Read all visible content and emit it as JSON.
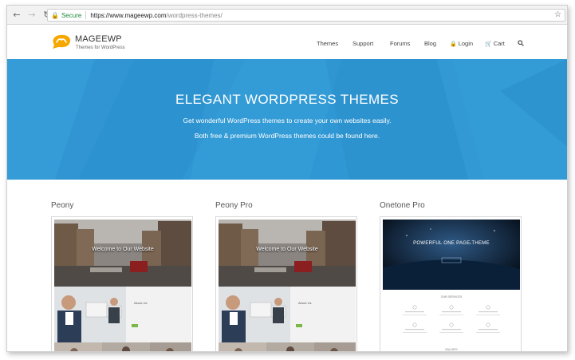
{
  "browser": {
    "back_icon": "arrow-left",
    "forward_icon": "arrow-right",
    "reload_icon": "reload",
    "secure_label": "Secure",
    "url_host": "https://www.mageewp.com",
    "url_path": "/wordpress-themes/",
    "bookmark_icon": "star"
  },
  "site": {
    "logo_title": "MAGEEWP",
    "logo_tagline": "Themes for WordPress",
    "logo_color": "#f6a800",
    "menu": [
      {
        "label": "Themes"
      },
      {
        "label": "Support"
      },
      {
        "label": "Forums"
      },
      {
        "label": "Blog"
      },
      {
        "label": "Login",
        "icon": "lock"
      },
      {
        "label": "Cart",
        "icon": "cart"
      },
      {
        "label": "",
        "icon": "search"
      }
    ]
  },
  "hero": {
    "title": "ELEGANT WORDPRESS THEMES",
    "line1": "Get wonderful WordPress themes to create your own websites easily.",
    "line2": "Both free & premium WordPress themes could be found here.",
    "background_color": "#2f97d3"
  },
  "themes": [
    {
      "name": "Peony",
      "preview_caption": "Welcome to Our Website",
      "preview_heading": "About Us"
    },
    {
      "name": "Peony Pro",
      "preview_caption": "Welcome to Our Website",
      "preview_heading": "About Us"
    },
    {
      "name": "Onetone Pro",
      "preview_caption": "POWERFUL ONE PAGE THEME",
      "preview_section": "OUR SERVICES",
      "preview_section2": "GALLERY"
    }
  ]
}
